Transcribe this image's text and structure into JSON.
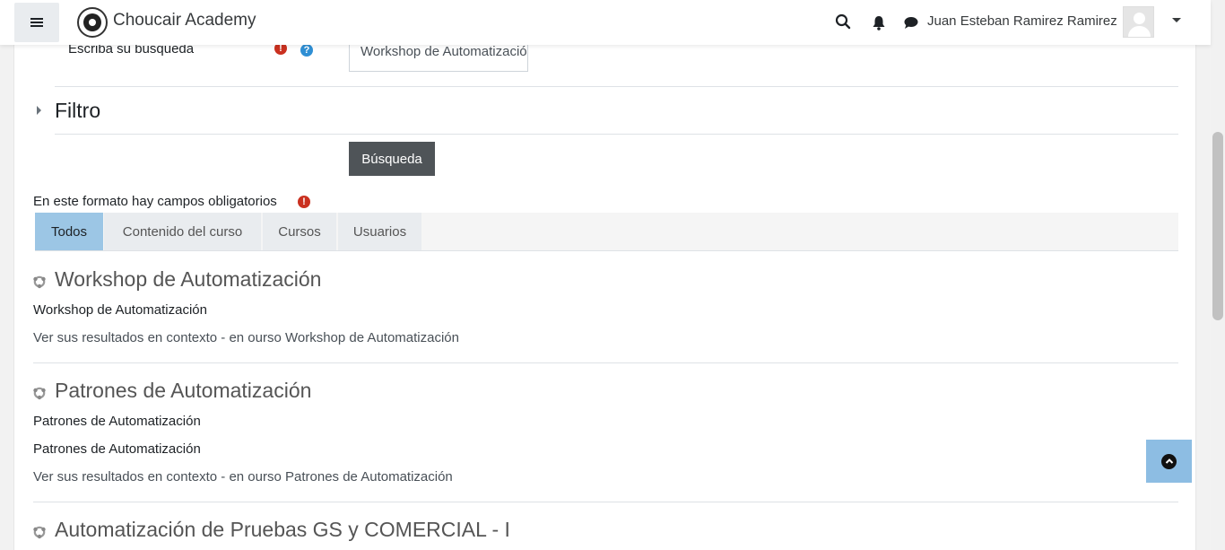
{
  "navbar": {
    "site_name": "Choucair Academy",
    "user_name": "Juan Esteban Ramirez Ramirez",
    "icons": [
      "menu-icon",
      "logo",
      "search-icon",
      "bell-icon",
      "chat-icon",
      "user-menu-caret"
    ]
  },
  "search_form": {
    "label": "Escriba su búsqueda",
    "input_value": "Workshop de Automatización",
    "filter_label": "Filtro",
    "submit_label": "Búsqueda",
    "required_note": "En este formato hay campos obligatorios"
  },
  "tabs": [
    {
      "label": "Todos",
      "active": true
    },
    {
      "label": "Contenido del curso",
      "active": false
    },
    {
      "label": "Cursos",
      "active": false
    },
    {
      "label": "Usuarios",
      "active": false
    }
  ],
  "results": [
    {
      "title": "Workshop de Automatización",
      "lines": [
        "Workshop de Automatización"
      ],
      "context": "Ver sus resultados en contexto - en ourso Workshop de Automatización"
    },
    {
      "title": "Patrones de Automatización",
      "lines": [
        "Patrones de Automatización",
        "Patrones de Automatización"
      ],
      "context": "Ver sus resultados en contexto - en ourso Patrones de Automatización"
    },
    {
      "title": "Automatización de Pruebas GS y COMERCIAL - I",
      "lines": [],
      "context": ""
    }
  ],
  "colors": {
    "accent_tab": "#9cc6e5",
    "button_dark": "#4f5458",
    "required_red": "#ca3120",
    "help_blue": "#2f8fd4",
    "back_to_top": "#8dbde3"
  }
}
